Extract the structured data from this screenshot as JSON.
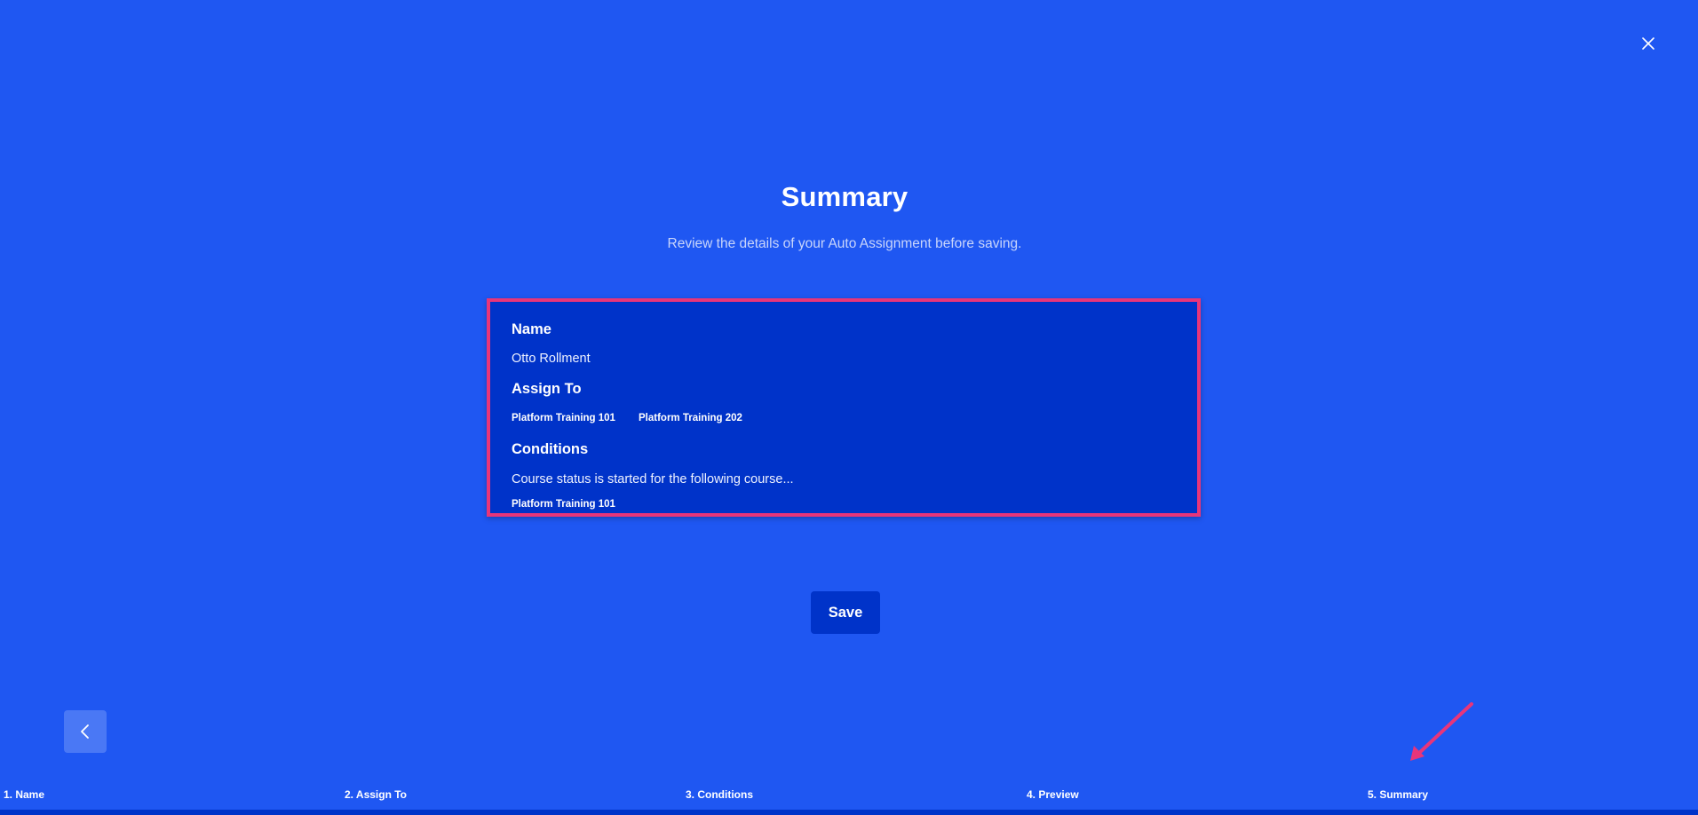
{
  "dialog": {
    "title": "Summary",
    "subtitle": "Review the details of your Auto Assignment before saving."
  },
  "summary": {
    "name_heading": "Name",
    "name_value": "Otto Rollment",
    "assign_heading": "Assign To",
    "assign_items": [
      "Platform Training 101",
      "Platform Training 202"
    ],
    "conditions_heading": "Conditions",
    "conditions_text": "Course status is started for the following course...",
    "conditions_items": [
      "Platform Training 101"
    ]
  },
  "actions": {
    "save_label": "Save"
  },
  "steps": [
    "1. Name",
    "2. Assign To",
    "3. Conditions",
    "4. Preview",
    "5. Summary"
  ],
  "progress": {
    "current_step": 5,
    "total_steps": 5
  },
  "icons": {
    "close": "close-icon",
    "back": "chevron-left-icon",
    "annotation": "arrow-annotation"
  },
  "colors": {
    "background": "#1f57f2",
    "card": "#0033c9",
    "highlight_border": "#e8357a",
    "button": "#0033c9",
    "back_button": "#4a78f5"
  }
}
